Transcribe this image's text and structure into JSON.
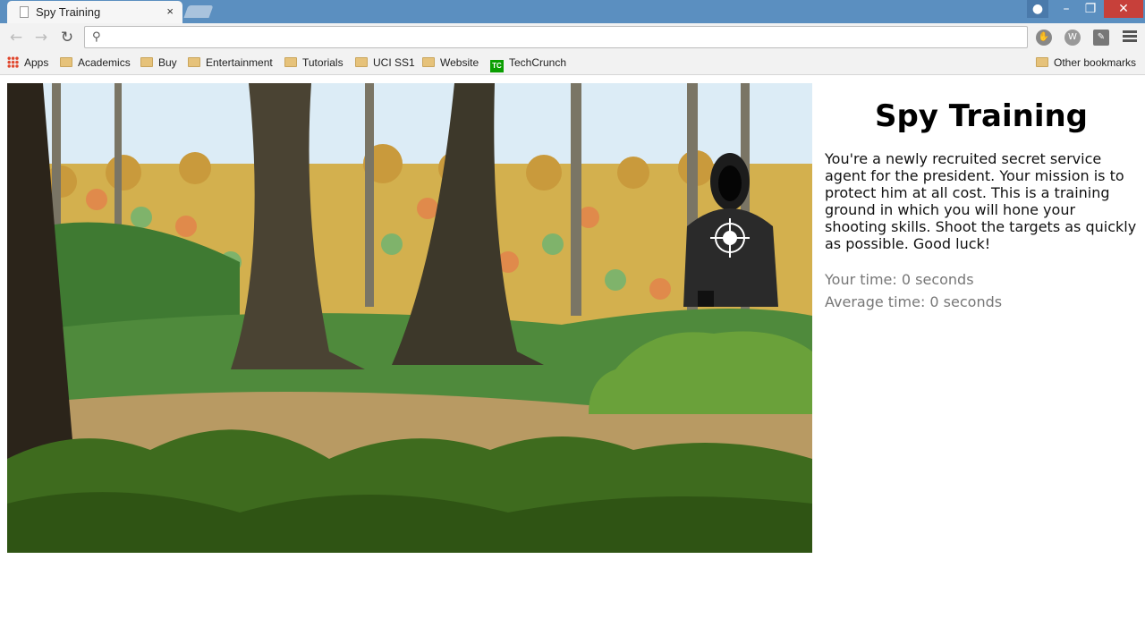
{
  "browser": {
    "tab_title": "Spy Training",
    "tab_close": "×",
    "url": ""
  },
  "bookmarks": [
    {
      "label": "Apps",
      "icon": "apps-icon"
    },
    {
      "label": "Academics",
      "icon": "folder-icon"
    },
    {
      "label": "Buy",
      "icon": "folder-icon"
    },
    {
      "label": "Entertainment",
      "icon": "folder-icon"
    },
    {
      "label": "Tutorials",
      "icon": "folder-icon"
    },
    {
      "label": "UCI SS1",
      "icon": "folder-icon"
    },
    {
      "label": "Website",
      "icon": "folder-icon"
    },
    {
      "label": "TechCrunch",
      "icon": "techcrunch-icon"
    }
  ],
  "other_bookmarks": "Other bookmarks",
  "page": {
    "title": "Spy Training",
    "description": "You're a newly recruited secret service agent for the president. Your mission is to protect him at all cost. This is a training ground in which you will hone your shooting skills. Shoot the targets as quickly as possible. Good luck!",
    "your_time": "Your time: 0 seconds",
    "average_time": "Average time: 0 seconds"
  },
  "colors": {
    "titlebar": "#5b8fc0",
    "close": "#c7403a",
    "sky": "#dcecf6",
    "grass": "#4f8a3c",
    "path": "#b89a63",
    "trunk": "#4a4333"
  }
}
